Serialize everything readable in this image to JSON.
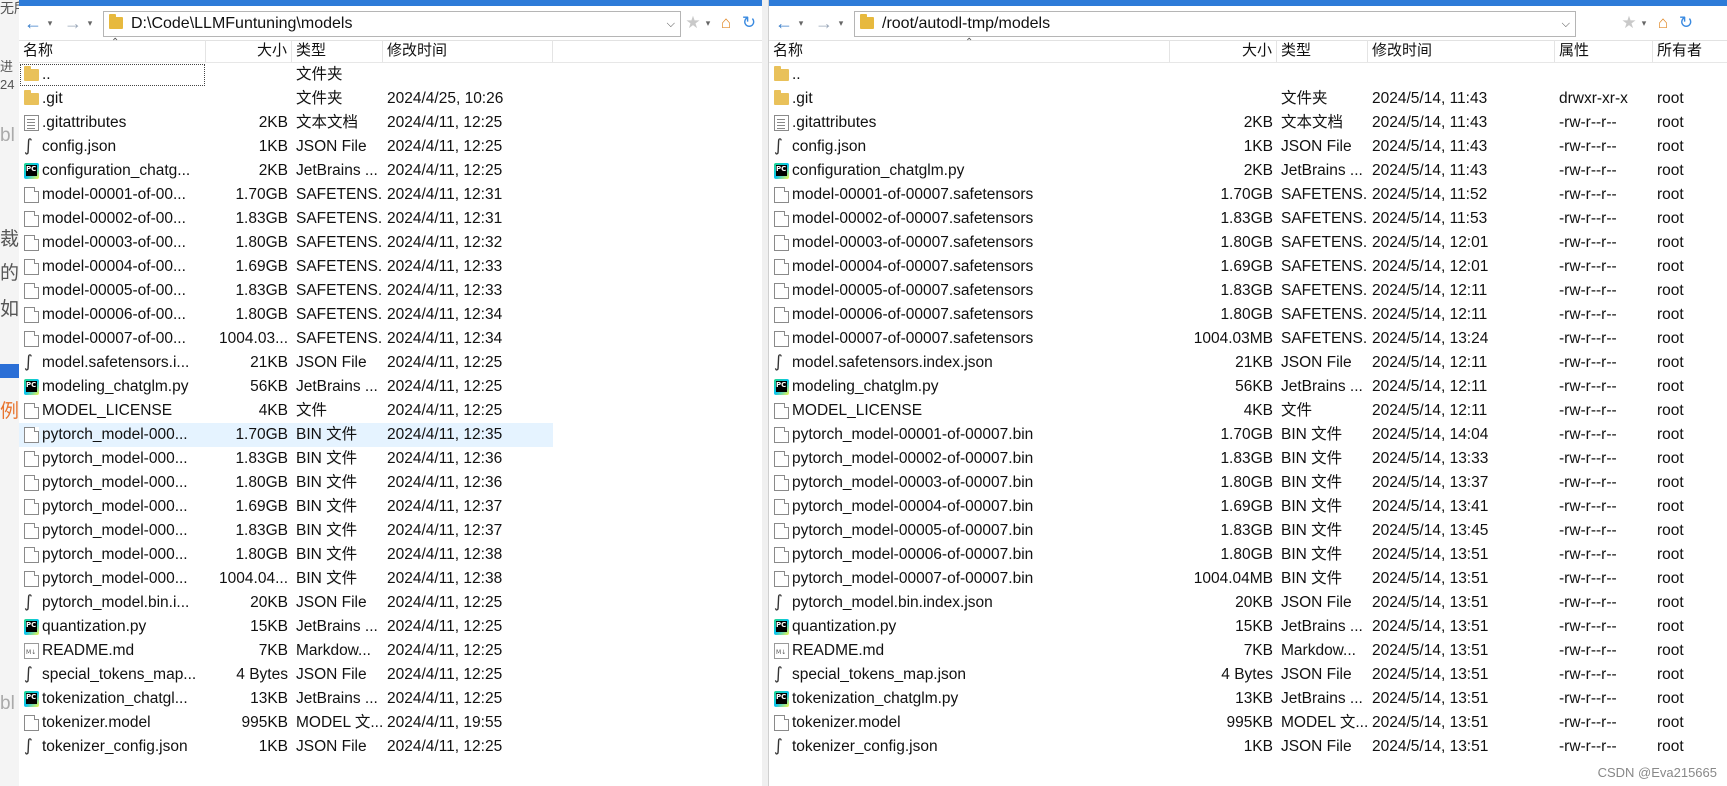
{
  "background_app": {
    "texts": [
      "无所",
      "进",
      "24",
      "bl",
      "裁",
      "的",
      "如",
      "例",
      "bl"
    ]
  },
  "colors": {
    "title_accent": "#2d7bd8",
    "selected_row": "#e5f3ff",
    "folder": "#e9c15a",
    "home_icon": "#e08a2a"
  },
  "left_pane": {
    "toolbar": {
      "back_icon": "arrow-left-icon",
      "forward_icon": "arrow-right-icon",
      "path": "D:\\Code\\LLMFuntuning\\models",
      "bookmark_icon": "star-icon",
      "home_icon": "home-icon",
      "refresh_icon": "refresh-icon"
    },
    "columns": {
      "name": "名称",
      "size": "大小",
      "type": "类型",
      "modified": "修改时间"
    },
    "files": [
      {
        "icon": "folder",
        "name": "..",
        "size": "",
        "type": "文件夹",
        "modified": ""
      },
      {
        "icon": "folder",
        "name": ".git",
        "size": "",
        "type": "文件夹",
        "modified": "2024/4/25, 10:26"
      },
      {
        "icon": "txt",
        "name": ".gitattributes",
        "size": "2KB",
        "type": "文本文档",
        "modified": "2024/4/11, 12:25"
      },
      {
        "icon": "json",
        "name": "config.json",
        "size": "1KB",
        "type": "JSON File",
        "modified": "2024/4/11, 12:25"
      },
      {
        "icon": "pc",
        "name": "configuration_chatg...",
        "size": "2KB",
        "type": "JetBrains ...",
        "modified": "2024/4/11, 12:25"
      },
      {
        "icon": "doc",
        "name": "model-00001-of-00...",
        "size": "1.70GB",
        "type": "SAFETENS...",
        "modified": "2024/4/11, 12:31"
      },
      {
        "icon": "doc",
        "name": "model-00002-of-00...",
        "size": "1.83GB",
        "type": "SAFETENS...",
        "modified": "2024/4/11, 12:31"
      },
      {
        "icon": "doc",
        "name": "model-00003-of-00...",
        "size": "1.80GB",
        "type": "SAFETENS...",
        "modified": "2024/4/11, 12:32"
      },
      {
        "icon": "doc",
        "name": "model-00004-of-00...",
        "size": "1.69GB",
        "type": "SAFETENS...",
        "modified": "2024/4/11, 12:33"
      },
      {
        "icon": "doc",
        "name": "model-00005-of-00...",
        "size": "1.83GB",
        "type": "SAFETENS...",
        "modified": "2024/4/11, 12:33"
      },
      {
        "icon": "doc",
        "name": "model-00006-of-00...",
        "size": "1.80GB",
        "type": "SAFETENS...",
        "modified": "2024/4/11, 12:34"
      },
      {
        "icon": "doc",
        "name": "model-00007-of-00...",
        "size": "1004.03...",
        "type": "SAFETENS...",
        "modified": "2024/4/11, 12:34"
      },
      {
        "icon": "json",
        "name": "model.safetensors.i...",
        "size": "21KB",
        "type": "JSON File",
        "modified": "2024/4/11, 12:25"
      },
      {
        "icon": "pc",
        "name": "modeling_chatglm.py",
        "size": "56KB",
        "type": "JetBrains ...",
        "modified": "2024/4/11, 12:25"
      },
      {
        "icon": "doc",
        "name": "MODEL_LICENSE",
        "size": "4KB",
        "type": "文件",
        "modified": "2024/4/11, 12:25"
      },
      {
        "icon": "doc",
        "name": "pytorch_model-000...",
        "size": "1.70GB",
        "type": "BIN 文件",
        "modified": "2024/4/11, 12:35",
        "selected": true
      },
      {
        "icon": "doc",
        "name": "pytorch_model-000...",
        "size": "1.83GB",
        "type": "BIN 文件",
        "modified": "2024/4/11, 12:36"
      },
      {
        "icon": "doc",
        "name": "pytorch_model-000...",
        "size": "1.80GB",
        "type": "BIN 文件",
        "modified": "2024/4/11, 12:36"
      },
      {
        "icon": "doc",
        "name": "pytorch_model-000...",
        "size": "1.69GB",
        "type": "BIN 文件",
        "modified": "2024/4/11, 12:37"
      },
      {
        "icon": "doc",
        "name": "pytorch_model-000...",
        "size": "1.83GB",
        "type": "BIN 文件",
        "modified": "2024/4/11, 12:37"
      },
      {
        "icon": "doc",
        "name": "pytorch_model-000...",
        "size": "1.80GB",
        "type": "BIN 文件",
        "modified": "2024/4/11, 12:38"
      },
      {
        "icon": "doc",
        "name": "pytorch_model-000...",
        "size": "1004.04...",
        "type": "BIN 文件",
        "modified": "2024/4/11, 12:38"
      },
      {
        "icon": "json",
        "name": "pytorch_model.bin.i...",
        "size": "20KB",
        "type": "JSON File",
        "modified": "2024/4/11, 12:25"
      },
      {
        "icon": "pc",
        "name": "quantization.py",
        "size": "15KB",
        "type": "JetBrains ...",
        "modified": "2024/4/11, 12:25"
      },
      {
        "icon": "md",
        "name": "README.md",
        "size": "7KB",
        "type": "Markdow...",
        "modified": "2024/4/11, 12:25"
      },
      {
        "icon": "json",
        "name": "special_tokens_map...",
        "size": "4 Bytes",
        "type": "JSON File",
        "modified": "2024/4/11, 12:25"
      },
      {
        "icon": "pc",
        "name": "tokenization_chatgl...",
        "size": "13KB",
        "type": "JetBrains ...",
        "modified": "2024/4/11, 12:25"
      },
      {
        "icon": "doc",
        "name": "tokenizer.model",
        "size": "995KB",
        "type": "MODEL 文...",
        "modified": "2024/4/11, 19:55"
      },
      {
        "icon": "json",
        "name": "tokenizer_config.json",
        "size": "1KB",
        "type": "JSON File",
        "modified": "2024/4/11, 12:25"
      }
    ]
  },
  "right_pane": {
    "toolbar": {
      "back_icon": "arrow-left-icon",
      "forward_icon": "arrow-right-icon",
      "path": "/root/autodl-tmp/models",
      "bookmark_icon": "star-icon",
      "home_icon": "home-icon",
      "refresh_icon": "refresh-icon"
    },
    "columns": {
      "name": "名称",
      "size": "大小",
      "type": "类型",
      "modified": "修改时间",
      "attributes": "属性",
      "owner": "所有者"
    },
    "files": [
      {
        "icon": "folder",
        "name": "..",
        "size": "",
        "type": "",
        "modified": "",
        "attr": "",
        "owner": ""
      },
      {
        "icon": "folder",
        "name": ".git",
        "size": "",
        "type": "文件夹",
        "modified": "2024/5/14, 11:43",
        "attr": "drwxr-xr-x",
        "owner": "root"
      },
      {
        "icon": "txt",
        "name": ".gitattributes",
        "size": "2KB",
        "type": "文本文档",
        "modified": "2024/5/14, 11:43",
        "attr": "-rw-r--r--",
        "owner": "root"
      },
      {
        "icon": "json",
        "name": "config.json",
        "size": "1KB",
        "type": "JSON File",
        "modified": "2024/5/14, 11:43",
        "attr": "-rw-r--r--",
        "owner": "root"
      },
      {
        "icon": "pc",
        "name": "configuration_chatglm.py",
        "size": "2KB",
        "type": "JetBrains ...",
        "modified": "2024/5/14, 11:43",
        "attr": "-rw-r--r--",
        "owner": "root"
      },
      {
        "icon": "doc",
        "name": "model-00001-of-00007.safetensors",
        "size": "1.70GB",
        "type": "SAFETENS...",
        "modified": "2024/5/14, 11:52",
        "attr": "-rw-r--r--",
        "owner": "root"
      },
      {
        "icon": "doc",
        "name": "model-00002-of-00007.safetensors",
        "size": "1.83GB",
        "type": "SAFETENS...",
        "modified": "2024/5/14, 11:53",
        "attr": "-rw-r--r--",
        "owner": "root"
      },
      {
        "icon": "doc",
        "name": "model-00003-of-00007.safetensors",
        "size": "1.80GB",
        "type": "SAFETENS...",
        "modified": "2024/5/14, 12:01",
        "attr": "-rw-r--r--",
        "owner": "root"
      },
      {
        "icon": "doc",
        "name": "model-00004-of-00007.safetensors",
        "size": "1.69GB",
        "type": "SAFETENS...",
        "modified": "2024/5/14, 12:01",
        "attr": "-rw-r--r--",
        "owner": "root"
      },
      {
        "icon": "doc",
        "name": "model-00005-of-00007.safetensors",
        "size": "1.83GB",
        "type": "SAFETENS...",
        "modified": "2024/5/14, 12:11",
        "attr": "-rw-r--r--",
        "owner": "root"
      },
      {
        "icon": "doc",
        "name": "model-00006-of-00007.safetensors",
        "size": "1.80GB",
        "type": "SAFETENS...",
        "modified": "2024/5/14, 12:11",
        "attr": "-rw-r--r--",
        "owner": "root"
      },
      {
        "icon": "doc",
        "name": "model-00007-of-00007.safetensors",
        "size": "1004.03MB",
        "type": "SAFETENS...",
        "modified": "2024/5/14, 13:24",
        "attr": "-rw-r--r--",
        "owner": "root"
      },
      {
        "icon": "json",
        "name": "model.safetensors.index.json",
        "size": "21KB",
        "type": "JSON File",
        "modified": "2024/5/14, 12:11",
        "attr": "-rw-r--r--",
        "owner": "root"
      },
      {
        "icon": "pc",
        "name": "modeling_chatglm.py",
        "size": "56KB",
        "type": "JetBrains ...",
        "modified": "2024/5/14, 12:11",
        "attr": "-rw-r--r--",
        "owner": "root"
      },
      {
        "icon": "doc",
        "name": "MODEL_LICENSE",
        "size": "4KB",
        "type": "文件",
        "modified": "2024/5/14, 12:11",
        "attr": "-rw-r--r--",
        "owner": "root"
      },
      {
        "icon": "doc",
        "name": "pytorch_model-00001-of-00007.bin",
        "size": "1.70GB",
        "type": "BIN 文件",
        "modified": "2024/5/14, 14:04",
        "attr": "-rw-r--r--",
        "owner": "root"
      },
      {
        "icon": "doc",
        "name": "pytorch_model-00002-of-00007.bin",
        "size": "1.83GB",
        "type": "BIN 文件",
        "modified": "2024/5/14, 13:33",
        "attr": "-rw-r--r--",
        "owner": "root"
      },
      {
        "icon": "doc",
        "name": "pytorch_model-00003-of-00007.bin",
        "size": "1.80GB",
        "type": "BIN 文件",
        "modified": "2024/5/14, 13:37",
        "attr": "-rw-r--r--",
        "owner": "root"
      },
      {
        "icon": "doc",
        "name": "pytorch_model-00004-of-00007.bin",
        "size": "1.69GB",
        "type": "BIN 文件",
        "modified": "2024/5/14, 13:41",
        "attr": "-rw-r--r--",
        "owner": "root"
      },
      {
        "icon": "doc",
        "name": "pytorch_model-00005-of-00007.bin",
        "size": "1.83GB",
        "type": "BIN 文件",
        "modified": "2024/5/14, 13:45",
        "attr": "-rw-r--r--",
        "owner": "root"
      },
      {
        "icon": "doc",
        "name": "pytorch_model-00006-of-00007.bin",
        "size": "1.80GB",
        "type": "BIN 文件",
        "modified": "2024/5/14, 13:51",
        "attr": "-rw-r--r--",
        "owner": "root"
      },
      {
        "icon": "doc",
        "name": "pytorch_model-00007-of-00007.bin",
        "size": "1004.04MB",
        "type": "BIN 文件",
        "modified": "2024/5/14, 13:51",
        "attr": "-rw-r--r--",
        "owner": "root"
      },
      {
        "icon": "json",
        "name": "pytorch_model.bin.index.json",
        "size": "20KB",
        "type": "JSON File",
        "modified": "2024/5/14, 13:51",
        "attr": "-rw-r--r--",
        "owner": "root"
      },
      {
        "icon": "pc",
        "name": "quantization.py",
        "size": "15KB",
        "type": "JetBrains ...",
        "modified": "2024/5/14, 13:51",
        "attr": "-rw-r--r--",
        "owner": "root"
      },
      {
        "icon": "md",
        "name": "README.md",
        "size": "7KB",
        "type": "Markdow...",
        "modified": "2024/5/14, 13:51",
        "attr": "-rw-r--r--",
        "owner": "root"
      },
      {
        "icon": "json",
        "name": "special_tokens_map.json",
        "size": "4 Bytes",
        "type": "JSON File",
        "modified": "2024/5/14, 13:51",
        "attr": "-rw-r--r--",
        "owner": "root"
      },
      {
        "icon": "pc",
        "name": "tokenization_chatglm.py",
        "size": "13KB",
        "type": "JetBrains ...",
        "modified": "2024/5/14, 13:51",
        "attr": "-rw-r--r--",
        "owner": "root"
      },
      {
        "icon": "doc",
        "name": "tokenizer.model",
        "size": "995KB",
        "type": "MODEL 文...",
        "modified": "2024/5/14, 13:51",
        "attr": "-rw-r--r--",
        "owner": "root"
      },
      {
        "icon": "json",
        "name": "tokenizer_config.json",
        "size": "1KB",
        "type": "JSON File",
        "modified": "2024/5/14, 13:51",
        "attr": "-rw-r--r--",
        "owner": "root"
      }
    ]
  },
  "watermark": "CSDN @Eva215665"
}
